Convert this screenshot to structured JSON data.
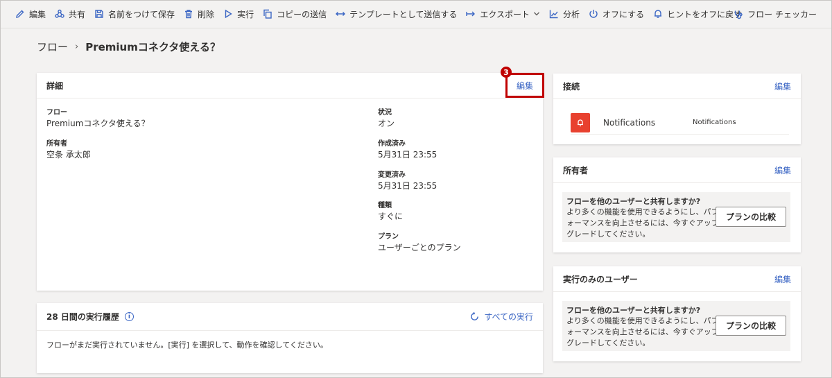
{
  "toolbar": {
    "items": [
      {
        "label": "編集",
        "icon": "pencil-icon"
      },
      {
        "label": "共有",
        "icon": "share-icon"
      },
      {
        "label": "名前をつけて保存",
        "icon": "save-as-icon"
      },
      {
        "label": "削除",
        "icon": "trash-icon"
      },
      {
        "label": "実行",
        "icon": "play-icon"
      },
      {
        "label": "コピーの送信",
        "icon": "copy-icon"
      },
      {
        "label": "テンプレートとして送信する",
        "icon": "arrows-horizontal-icon"
      },
      {
        "label": "エクスポート",
        "icon": "export-icon"
      },
      {
        "label": "分析",
        "icon": "chart-icon"
      },
      {
        "label": "オフにする",
        "icon": "power-icon"
      },
      {
        "label": "ヒントをオフに戻す",
        "icon": "bell-icon"
      }
    ],
    "checker": {
      "label": "フロー チェッカー",
      "icon": "stethoscope-icon"
    }
  },
  "breadcrumb": {
    "root": "フロー",
    "separator": "›",
    "current": "Premiumコネクタ使える？"
  },
  "details": {
    "title": "詳細",
    "edit": "編集",
    "step_badge": "3",
    "flow_label": "フロー",
    "flow_value": "Premiumコネクタ使える？",
    "owner_label": "所有者",
    "owner_value": "空条 承太郎",
    "status_label": "状況",
    "status_value": "オン",
    "created_label": "作成済み",
    "created_value": "5月31日 23:55",
    "modified_label": "変更済み",
    "modified_value": "5月31日 23:55",
    "type_label": "種類",
    "type_value": "すぐに",
    "plan_label": "プラン",
    "plan_value": "ユーザーごとのプラン"
  },
  "history": {
    "title": "28 日間の実行履歴",
    "all_runs": "すべての実行",
    "empty_text": "フローがまだ実行されていません。[実行] を選択して、動作を確認してください。"
  },
  "connections": {
    "title": "接続",
    "edit": "編集",
    "items": [
      {
        "name": "Notifications",
        "detail": "Notifications"
      }
    ]
  },
  "owners": {
    "title": "所有者",
    "edit": "編集",
    "question": "フローを他のユーザーと共有しますか?",
    "description": "より多くの機能を使用できるようにし、パフォーマンスを向上させるには、今すぐアップグレードしてください。",
    "button": "プランの比較"
  },
  "run_only": {
    "title": "実行のみのユーザー",
    "edit": "編集",
    "question": "フローを他のユーザーと共有しますか?",
    "description": "より多くの機能を使用できるようにし、パフォーマンスを向上させるには、今すぐアップグレードしてください。",
    "button": "プランの比較"
  },
  "colors": {
    "accent": "#3b66c4",
    "highlight": "#c00000",
    "notification": "#e8412f"
  }
}
